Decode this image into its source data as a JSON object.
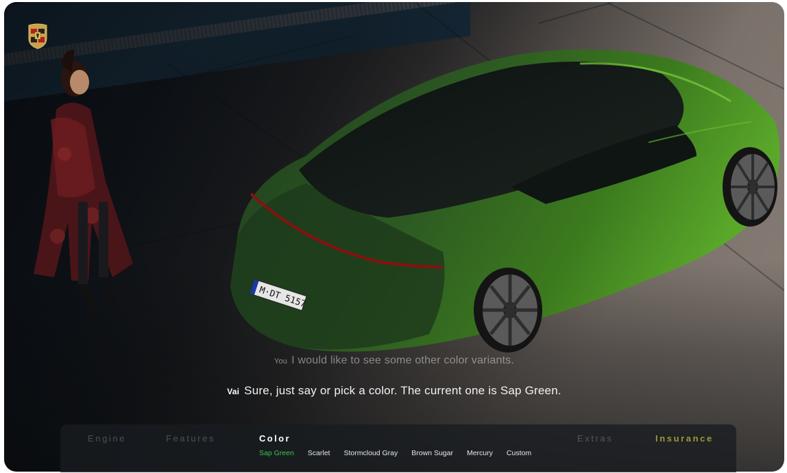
{
  "brand": {
    "logo_icon": "porsche-crest-icon"
  },
  "scene": {
    "car_color": "#3c7a1e",
    "license_plate": "M·DT 5157"
  },
  "conversation": {
    "user": {
      "speaker": "You",
      "text": "I would like to see some other color variants."
    },
    "assistant": {
      "speaker": "Vai",
      "text": "Sure, just say or pick a color. The current one is Sap Green."
    }
  },
  "config": {
    "categories": [
      {
        "label": "Engine"
      },
      {
        "label": "Features"
      },
      {
        "label": "Color"
      },
      {
        "label": "Extras"
      },
      {
        "label": "Insurance"
      }
    ],
    "active_category": "Color",
    "colors": [
      {
        "label": "Sap Green"
      },
      {
        "label": "Scarlet"
      },
      {
        "label": "Stormcloud Gray"
      },
      {
        "label": "Brown Sugar"
      },
      {
        "label": "Mercury"
      },
      {
        "label": "Custom"
      }
    ],
    "selected_color": "Sap Green",
    "accent_selected": "#3fc34a",
    "accent_insurance": "#9a9a3a"
  }
}
